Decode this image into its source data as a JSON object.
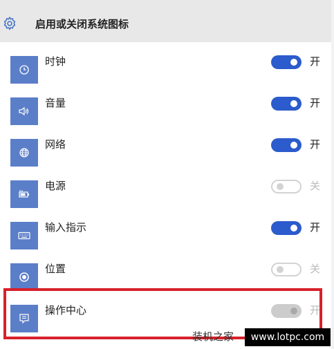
{
  "header": {
    "title": "启用或关闭系统图标",
    "icon": "gear-icon"
  },
  "rows": [
    {
      "label": "时钟",
      "icon": "clock-icon",
      "state": "on",
      "state_label": "开"
    },
    {
      "label": "音量",
      "icon": "speaker-icon",
      "state": "on",
      "state_label": "开"
    },
    {
      "label": "网络",
      "icon": "globe-icon",
      "state": "on",
      "state_label": "开"
    },
    {
      "label": "电源",
      "icon": "battery-icon",
      "state": "off",
      "state_label": "关"
    },
    {
      "label": "输入指示",
      "icon": "keyboard-icon",
      "state": "on",
      "state_label": "开"
    },
    {
      "label": "位置",
      "icon": "location-icon",
      "state": "off",
      "state_label": "关"
    },
    {
      "label": "操作中心",
      "icon": "action-center-icon",
      "state": "disabled",
      "state_label": "开"
    }
  ],
  "watermark": {
    "site_name": "装机之家",
    "url": "www.lotpc.com"
  },
  "colors": {
    "accent": "#2b5bcc",
    "icon_tile": "#5b7ec8",
    "header_bg": "#e8e8e8",
    "highlight": "#d8202a"
  }
}
